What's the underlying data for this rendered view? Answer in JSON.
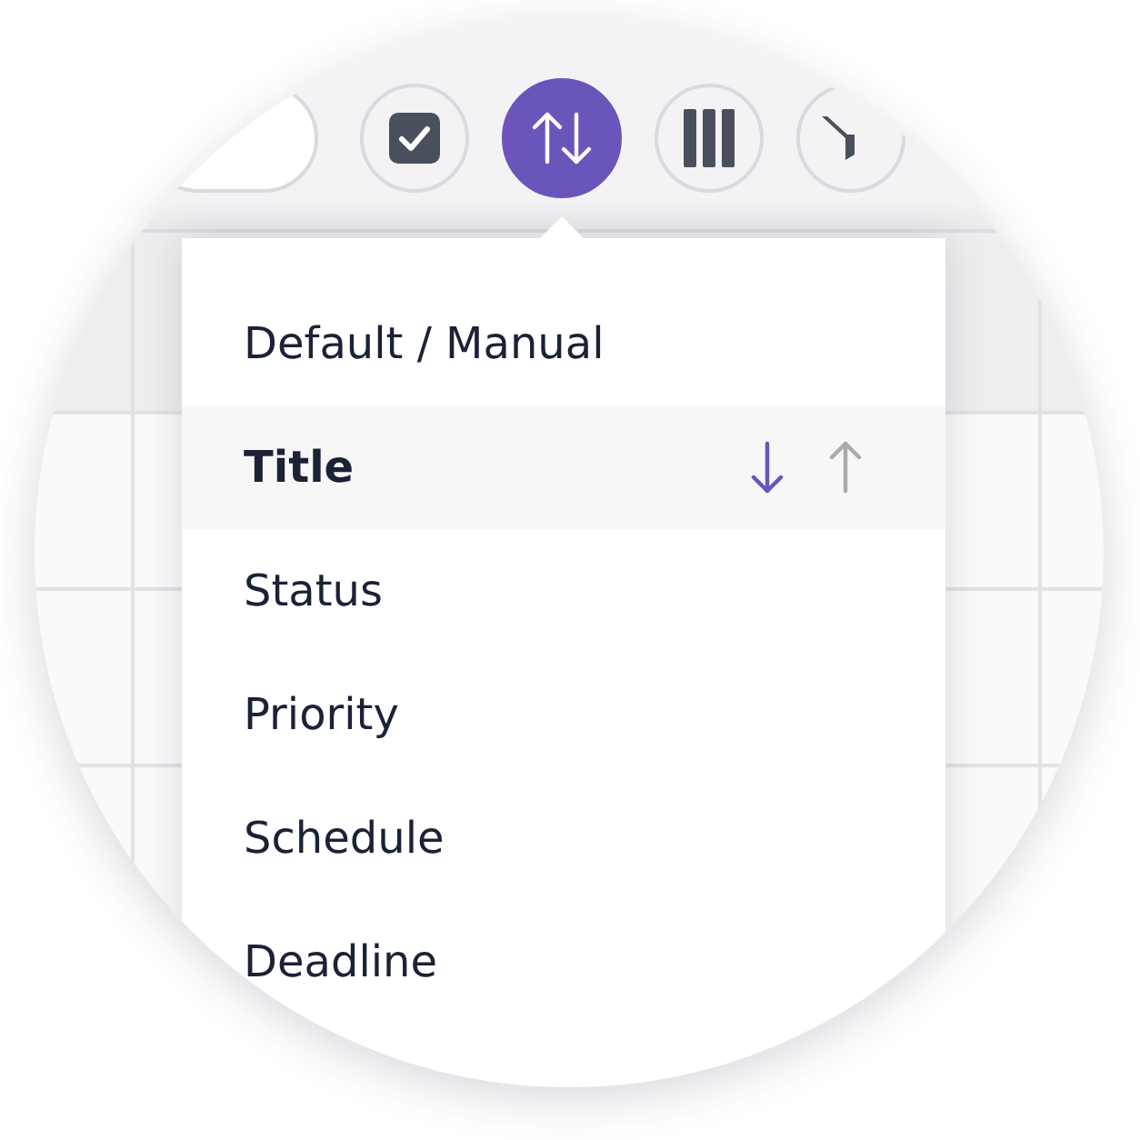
{
  "toolbar": [
    {
      "kind": "pill",
      "selected": false
    },
    {
      "kind": "checkbox",
      "selected": false
    },
    {
      "kind": "sort",
      "selected": true
    },
    {
      "kind": "columns",
      "selected": false
    },
    {
      "kind": "funnel",
      "selected": false
    }
  ],
  "sort_menu": {
    "items": [
      {
        "label": "Default / Manual",
        "selected": false
      },
      {
        "label": "Title",
        "selected": true,
        "directions": [
          {
            "kind": "descending",
            "selected": true
          },
          {
            "kind": "ascending",
            "selected": false
          }
        ]
      },
      {
        "label": "Status",
        "selected": false
      },
      {
        "label": "Priority",
        "selected": false
      },
      {
        "label": "Schedule",
        "selected": false
      },
      {
        "label": "Deadline",
        "selected": false
      }
    ]
  }
}
